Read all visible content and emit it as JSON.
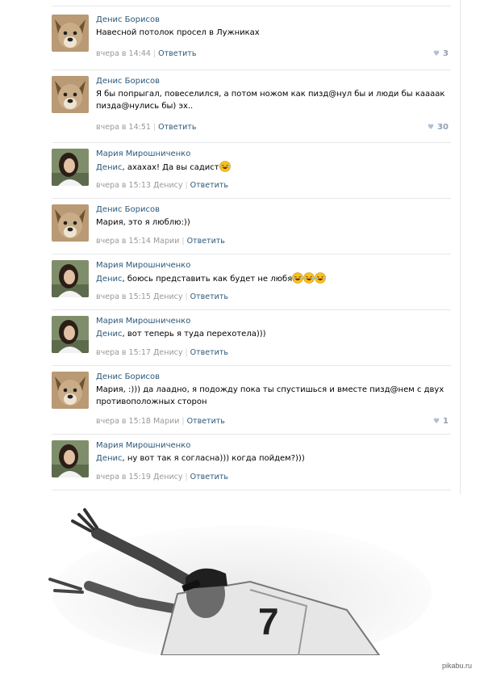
{
  "comments": [
    {
      "avatar": "dog-avatar",
      "author": "Денис Борисов",
      "mention": "",
      "text": "Навесной потолок просел в Лужниках",
      "emoji_count": 0,
      "time": "вчера в 14:44",
      "reply_to": "",
      "reply_label": "Ответить",
      "likes": "3"
    },
    {
      "avatar": "dog-avatar",
      "author": "Денис Борисов",
      "mention": "",
      "text": "Я бы попрыгал, повеселился, а потом ножом как пизд@нул бы и люди бы кааaак пизда@нулись бы) эх..",
      "emoji_count": 0,
      "time": "вчера в 14:51",
      "reply_to": "",
      "reply_label": "Ответить",
      "likes": "30"
    },
    {
      "avatar": "woman-avatar",
      "author": "Мария Мирошниченко",
      "mention": "Денис",
      "text": ", ахахах! Да вы садист",
      "emoji_count": 1,
      "time": "вчера в 15:13",
      "reply_to": "Денису",
      "reply_label": "Ответить",
      "likes": ""
    },
    {
      "avatar": "dog-avatar",
      "author": "Денис Борисов",
      "mention": "",
      "text": "Мария, это я люблю:))",
      "emoji_count": 0,
      "time": "вчера в 15:14",
      "reply_to": "Марии",
      "reply_label": "Ответить",
      "likes": ""
    },
    {
      "avatar": "woman-avatar",
      "author": "Мария Мирошниченко",
      "mention": "Денис",
      "text": ", боюсь представить как будет не любя",
      "emoji_count": 3,
      "time": "вчера в 15:15",
      "reply_to": "Денису",
      "reply_label": "Ответить",
      "likes": ""
    },
    {
      "avatar": "woman-avatar",
      "author": "Мария Мирошниченко",
      "mention": "Денис",
      "text": ", вот теперь я туда перехотела)))",
      "emoji_count": 0,
      "time": "вчера в 15:17",
      "reply_to": "Денису",
      "reply_label": "Ответить",
      "likes": ""
    },
    {
      "avatar": "dog-avatar",
      "author": "Денис Борисов",
      "mention": "",
      "text": "Мария, :))) да лаадно, я подожду пока ты спустишься и вместе пизд@нем с двух противоположных сторон",
      "emoji_count": 0,
      "time": "вчера в 15:18",
      "reply_to": "Марии",
      "reply_label": "Ответить",
      "likes": "1"
    },
    {
      "avatar": "woman-avatar",
      "author": "Мария Мирошниченко",
      "mention": "Денис",
      "text": ", ну вот так я согласна))) когда пойдем?)))",
      "emoji_count": 0,
      "time": "вчера в 15:19",
      "reply_to": "Денису",
      "reply_label": "Ответить",
      "likes": ""
    }
  ],
  "photo": {
    "jersey_number": "7"
  },
  "watermark": "pikabu.ru",
  "colors": {
    "link": "#2b587a",
    "meta": "#999999",
    "divider": "#e7e8ec"
  }
}
